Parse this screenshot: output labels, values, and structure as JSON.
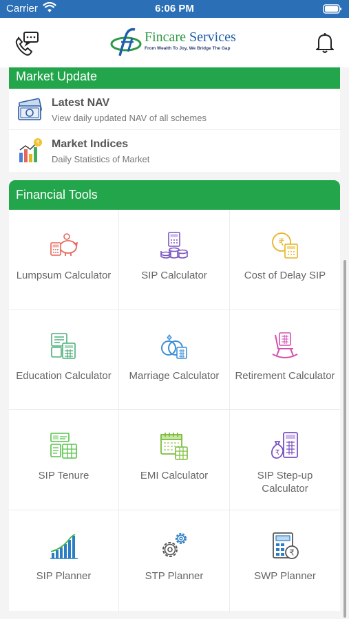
{
  "status_bar": {
    "carrier": "Carrier",
    "time": "6:06 PM"
  },
  "header": {
    "logo_brand": "Fincare",
    "logo_rest": "Services",
    "logo_tagline": "From Wealth To Joy, We Bridge The Gap",
    "left_icon": "phone-chat-icon",
    "right_icon": "bell-icon"
  },
  "market_update": {
    "title": "Market Update",
    "items": [
      {
        "title": "Latest NAV",
        "subtitle": "View daily updated NAV of all schemes",
        "icon": "banknote-icon"
      },
      {
        "title": "Market Indices",
        "subtitle": "Daily Statistics of Market",
        "icon": "bar-chart-rupee-icon"
      }
    ]
  },
  "financial_tools": {
    "title": "Financial Tools",
    "items": [
      {
        "label": "Lumpsum Calculator",
        "icon": "piggy-bank-icon",
        "color": "#e5675c"
      },
      {
        "label": "SIP Calculator",
        "icon": "coin-stack-icon",
        "color": "#7b55c2"
      },
      {
        "label": "Cost of Delay SIP",
        "icon": "rupee-clock-calculator-icon",
        "color": "#e6b422"
      },
      {
        "label": "Education Calculator",
        "icon": "education-calculator-icon",
        "color": "#4caf7a"
      },
      {
        "label": "Marriage Calculator",
        "icon": "rings-icon",
        "color": "#3c8fd6"
      },
      {
        "label": "Retirement Calculator",
        "icon": "rocking-chair-icon",
        "color": "#d44fb0"
      },
      {
        "label": "SIP Tenure",
        "icon": "sip-tenure-icon",
        "color": "#55c24a"
      },
      {
        "label": "EMI Calculator",
        "icon": "calendar-calculator-icon",
        "color": "#7cbd3a"
      },
      {
        "label": "SIP Step-up Calculator",
        "icon": "money-bag-calculator-icon",
        "color": "#7a4fc4"
      },
      {
        "label": "SIP Planner",
        "icon": "growth-chart-icon",
        "color": "#2b7ec4"
      },
      {
        "label": "STP Planner",
        "icon": "gears-icon",
        "color": "#555555"
      },
      {
        "label": "SWP Planner",
        "icon": "rupee-calculator-icon",
        "color": "#2b7ec4"
      }
    ]
  },
  "colors": {
    "status_bar": "#2b6fb6",
    "accent_green": "#22a54b",
    "logo_blue": "#1e5fa8"
  }
}
